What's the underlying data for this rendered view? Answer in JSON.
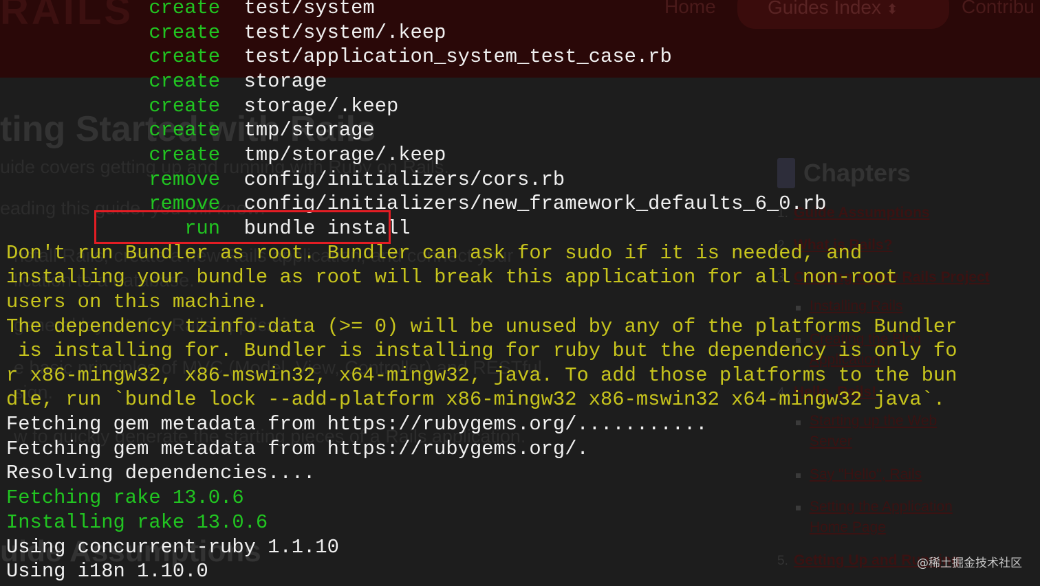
{
  "background_page": {
    "logo": "RAILS",
    "nav": {
      "home": "Home",
      "guides_index": "Guides Index",
      "contribute": "Contribu"
    },
    "heading": "ting Started with Rails",
    "intro_1": "uide covers getting up and running with Ruby on Rails.",
    "intro_2": "eading this guide, you will know:",
    "bullet_a": "nstall Rails, create a new Rails application, and connect your",
    "bullet_b": "lication to a database.",
    "bullet_c": "general layout of a Rails application.",
    "bullet_d": "e basic principles of MVC (Model, View, Controller) and RESTful",
    "bullet_e": "sign.",
    "bullet_f": "w to quickly generate the starting pieces of a Rails application.",
    "section_heading": "uide Assumptions",
    "chapters": {
      "title": "Chapters",
      "items": [
        {
          "num": "1.",
          "label": "Guide Assumptions"
        },
        {
          "num": "2.",
          "label": "What is Rails?"
        },
        {
          "num": "3.",
          "label": "Creating a New Rails Project"
        },
        {
          "sub": "Installing Rails"
        },
        {
          "sub": "Creating the Blog"
        },
        {
          "sub": "Application"
        },
        {
          "num": "4.",
          "label": "Hello, Rails!"
        },
        {
          "sub": "Starting up the Web"
        },
        {
          "sub": "Server"
        },
        {
          "sub": "Say \"Hello\", Rails"
        },
        {
          "sub": "Setting the Application"
        },
        {
          "sub": "Home Page"
        },
        {
          "num": "5.",
          "label": "Getting Up and Running"
        }
      ]
    }
  },
  "terminal": {
    "lines": [
      {
        "action": "create",
        "path": "test/system",
        "action_color": "green"
      },
      {
        "action": "create",
        "path": "test/system/.keep",
        "action_color": "green"
      },
      {
        "action": "create",
        "path": "test/application_system_test_case.rb",
        "action_color": "green"
      },
      {
        "action": "create",
        "path": "storage",
        "action_color": "green"
      },
      {
        "action": "create",
        "path": "storage/.keep",
        "action_color": "green"
      },
      {
        "action": "create",
        "path": "tmp/storage",
        "action_color": "green"
      },
      {
        "action": "create",
        "path": "tmp/storage/.keep",
        "action_color": "green"
      },
      {
        "action": "remove",
        "path": "config/initializers/cors.rb",
        "action_color": "green"
      },
      {
        "action": "remove",
        "path": "config/initializers/new_framework_defaults_6_0.rb",
        "action_color": "green"
      },
      {
        "action": "run",
        "path": "bundle install",
        "action_color": "green",
        "highlighted": true
      },
      {
        "text": "Don't run Bundler as root. Bundler can ask for sudo if it is needed, and",
        "color": "yellow"
      },
      {
        "text": "installing your bundle as root will break this application for all non-root",
        "color": "yellow"
      },
      {
        "text": "users on this machine.",
        "color": "yellow"
      },
      {
        "text": "The dependency tzinfo-data (>= 0) will be unused by any of the platforms Bundler",
        "color": "yellow"
      },
      {
        "text": " is installing for. Bundler is installing for ruby but the dependency is only fo",
        "color": "yellow"
      },
      {
        "text": "r x86-mingw32, x86-mswin32, x64-mingw32, java. To add those platforms to the bun",
        "color": "yellow"
      },
      {
        "text": "dle, run `bundle lock --add-platform x86-mingw32 x86-mswin32 x64-mingw32 java`.",
        "color": "yellow"
      },
      {
        "text": "Fetching gem metadata from https://rubygems.org/...........",
        "color": "white"
      },
      {
        "text": "Fetching gem metadata from https://rubygems.org/.",
        "color": "white"
      },
      {
        "text": "Resolving dependencies....",
        "color": "white"
      },
      {
        "text": "Fetching rake 13.0.6",
        "color": "green"
      },
      {
        "text": "Installing rake 13.0.6",
        "color": "green"
      },
      {
        "text": "Using concurrent-ruby 1.1.10",
        "color": "white"
      },
      {
        "text": "Using i18n 1.10.0",
        "color": "white"
      }
    ]
  },
  "watermark": "@稀土掘金技术社区",
  "colors": {
    "green": "#21c521",
    "yellow": "#c7c41d",
    "white": "#f0f0f0",
    "highlight_border": "#e31d24",
    "background": "#1d1d1d"
  }
}
